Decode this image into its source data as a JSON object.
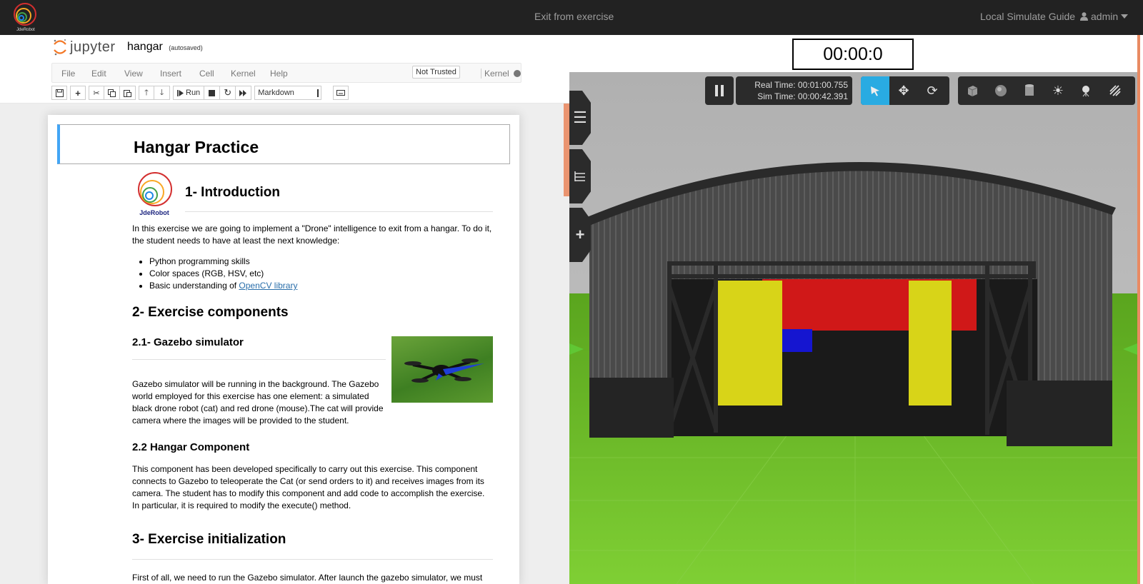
{
  "topbar": {
    "logo_text": "JdeRobot",
    "exit_label": "Exit from exercise",
    "guide_label": "Local Simulate Guide",
    "user_label": "admin"
  },
  "jupyter": {
    "logo_text": "jupyter",
    "notebook_name": "hangar",
    "save_status": "(autosaved)",
    "menu": [
      "File",
      "Edit",
      "View",
      "Insert",
      "Cell",
      "Kernel",
      "Help"
    ],
    "trust_label": "Not Trusted",
    "kernel_label": "Kernel",
    "run_label": "Run",
    "cell_type": "Markdown"
  },
  "notebook": {
    "title": "Hangar Practice",
    "logo_caption": "JdeRobot",
    "intro_heading": "1- Introduction",
    "intro_text": "In this exercise we are going to implement a \"Drone\" intelligence to exit from a hangar. To do it, the student needs to have at least the next knowledge:",
    "bullets": [
      "Python programming skills",
      "Color spaces (RGB, HSV, etc)",
      "Basic understanding of "
    ],
    "bullet_link": "OpenCV library",
    "components_heading": "2- Exercise components",
    "gazebo_heading": "2.1- Gazebo simulator",
    "gazebo_text": "Gazebo simulator will be running in the background. The Gazebo world employed for this exercise has one element: a simulated black drone robot (cat) and red drone (mouse).The cat will provide camera where the images will be provided to the student.",
    "hangar_heading": "2.2 Hangar Component",
    "hangar_text": "This component has been developed specifically to carry out this exercise. This component connects to Gazebo to teleoperate the Cat (or send orders to it) and receives images from its camera. The student has to modify this component and add code to accomplish the exercise. In particular, it is required to modify the execute() method.",
    "init_heading": "3- Exercise initialization",
    "init_text": "First of all, we need to run the Gazebo simulator. After launch the gazebo simulator, we must"
  },
  "simulator": {
    "timer": "00:00:0",
    "real_time": "Real Time: 00:01:00.755",
    "sim_time": "Sim Time: 00:00:42.391"
  },
  "colors": {
    "accent_blue": "#42a5f5",
    "gz_active": "#29abe2",
    "scroll_orange": "#e98a62",
    "ground_green": "#6fbe2b"
  }
}
